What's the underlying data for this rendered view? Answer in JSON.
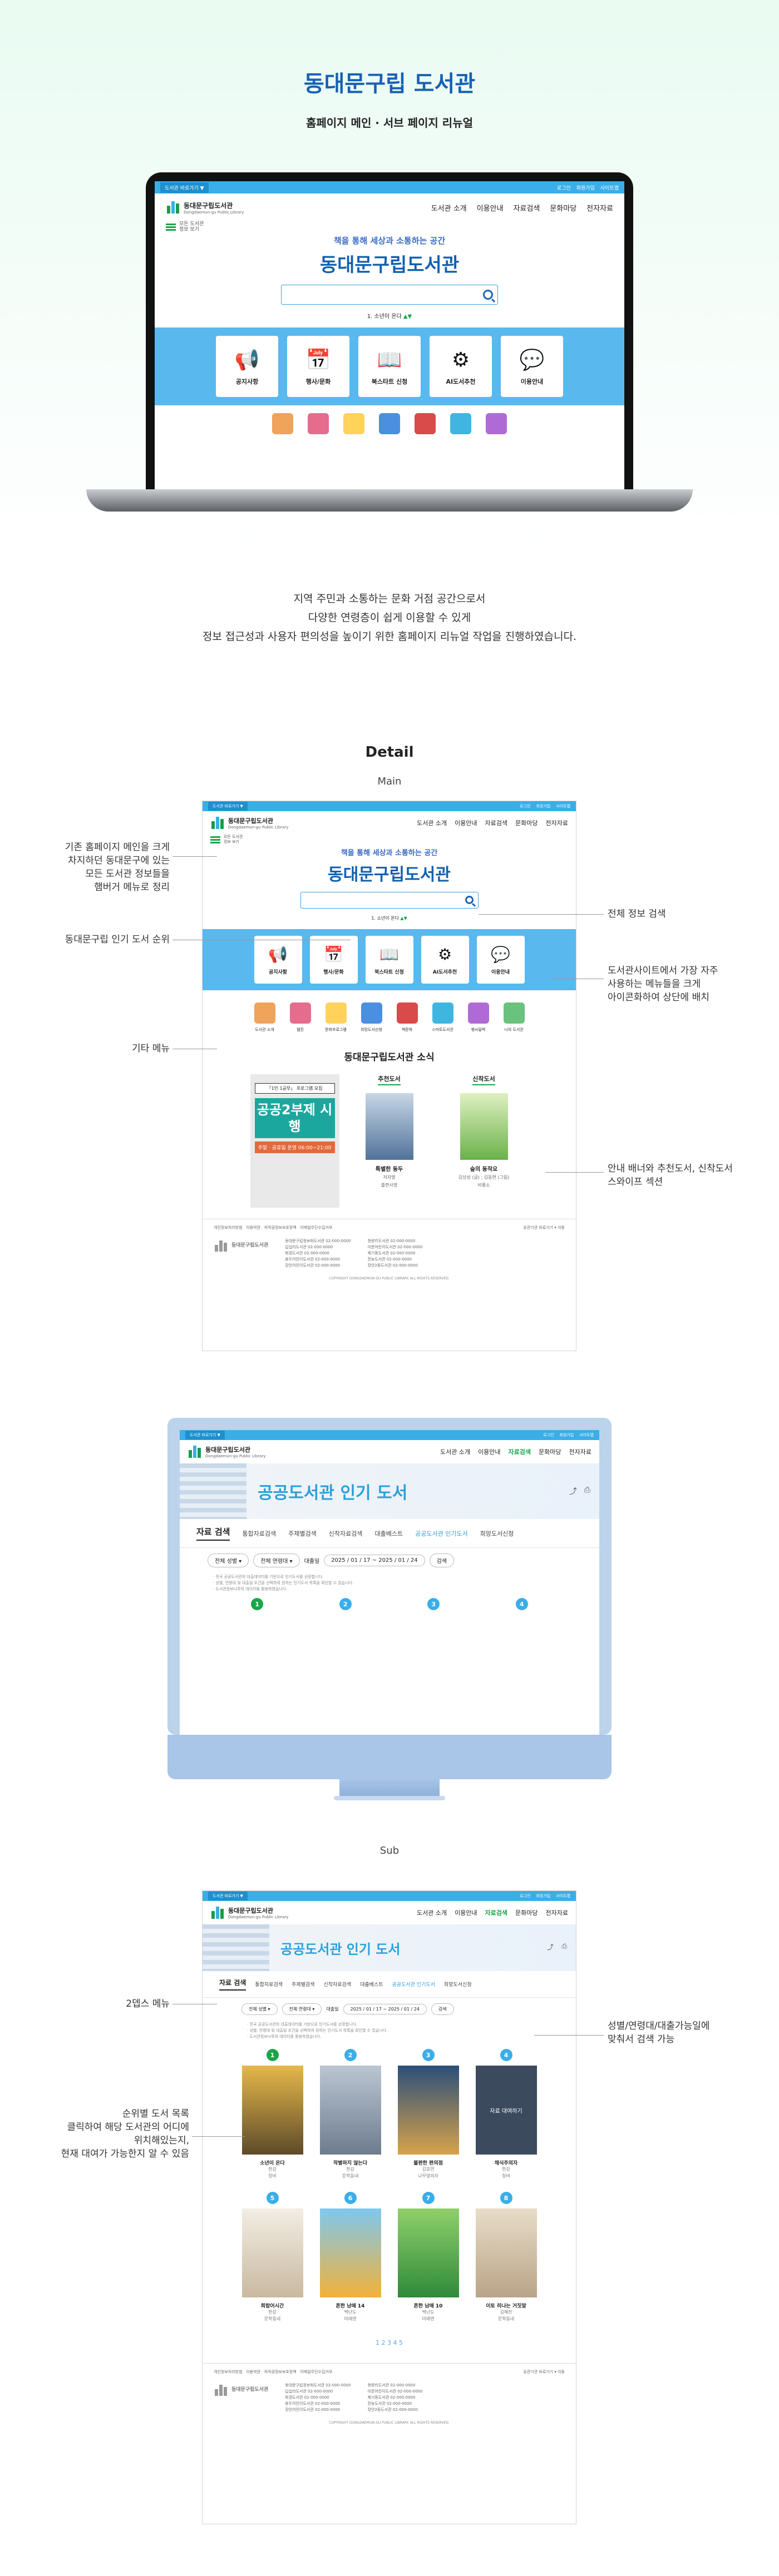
{
  "page": {
    "title": "동대문구립 도서관",
    "subtitle": "홈페이지 메인 · 서브 페이지 리뉴얼",
    "description": [
      "지역 주민과 소통하는 문화 거점 공간으로서",
      "다양한 연령층이 쉽게 이용할 수 있게",
      "정보 접근성과 사용자 편의성을 높이기 위한 홈페이지 리뉴얼 작업을 진행하였습니다."
    ],
    "detail_heading": "Detail",
    "main_label": "Main",
    "sub_label": "Sub"
  },
  "site": {
    "top_select": "도서관 바로가기 ▼",
    "top_links": [
      "로그인",
      "회원가입",
      "사이트맵"
    ],
    "logo_name": "동대문구립도서관",
    "logo_en": "Dongdaemun-gu Public Library",
    "gnb": [
      "도서관 소개",
      "이용안내",
      "자료검색",
      "문화마당",
      "전자자료"
    ],
    "sitemap_label": [
      "모든 도서관",
      "정보 보기"
    ],
    "slogan": "책을 통해 세상과 소통하는 공간",
    "big_title": "동대문구립도서관",
    "popular_rank": "1. 소년이 온다",
    "quick_menu": [
      "공지사항",
      "행사/문화",
      "북스타트 신청",
      "AI도서추천",
      "이용안내"
    ],
    "quick_icons": [
      "megaphone-icon",
      "calendar-icon",
      "book-icon",
      "gear-icon",
      "chat-icon"
    ],
    "etc_menu": [
      "도서관 소개",
      "웹진",
      "문화프로그램",
      "희망도서신청",
      "책문화",
      "스마트도서관",
      "행사달력",
      "나의 도서관"
    ],
    "news_title": "동대문구립도서관 소식",
    "banner": {
      "small": "「1인 1공부」 프로그램 모집",
      "big": "공공2부제 시행",
      "time": "주말 · 공휴일 운영 06:00~21:00"
    },
    "recommend": {
      "head": "추천도서",
      "title": "특별한 동두",
      "meta": [
        "저자명",
        "출판사명"
      ]
    },
    "newbook": {
      "head": "신착도서",
      "title": "숲의 동작요",
      "meta": [
        "김상성 (글) ; 김동현 (그림)",
        "비룡소"
      ]
    },
    "footer_links": [
      "개인정보처리방침",
      "이용약관",
      "저작권정보보호정책",
      "이메일무단수집거부"
    ],
    "footer_site": "유관기관 바로가기 ▾",
    "footer_site_btn": "이동",
    "footer_cols": [
      [
        "동대문구립정보화도서관 02-000-0000",
        "답십리도서관 02-000-0000",
        "휘경도서관 02-000-0000",
        "용두어린이도서관 02-000-0000",
        "장안어린이도서관 02-000-0000"
      ],
      [
        "청량리도서관 02-000-0000",
        "이문어린이도서관 02-000-0000",
        "제기동도서관 02-000-0000",
        "전농도서관 02-000-0000",
        "장안2동도서관 02-000-0000"
      ]
    ],
    "copyright": "COPYRIGHT DONGDAEMUN-GU PUBLIC LIBRARY. ALL RIGHTS RESERVED."
  },
  "callouts": {
    "left1": [
      "기존 홈페이지 메인을 크게",
      "차지하던 동대문구에 있는",
      "모든 도서관 정보들을",
      "햄버거 메뉴로 정리"
    ],
    "left2": [
      "동대문구립 인기 도서 순위"
    ],
    "left3": [
      "기타 메뉴"
    ],
    "right1": [
      "전체 정보 검색"
    ],
    "right2": [
      "도서관사이트에서 가장 자주",
      "사용하는 메뉴들을 크게",
      "아이콘화하여 상단에 배치"
    ],
    "right3": [
      "안내 배너와 추천도서, 신착도서",
      "스와이프 섹션"
    ],
    "sub_left1": [
      "2뎁스 메뉴"
    ],
    "sub_left2": [
      "순위별 도서 목록",
      "클릭하여 해당 도서관의 어디에",
      "위치해있는지,",
      "현재 대여가 가능한지 알 수 있음"
    ],
    "sub_right1": [
      "성별/연령대/대출가능일에",
      "맞춰서 검색 가능"
    ]
  },
  "subpage": {
    "hero_title": "공공도서관 인기 도서",
    "lead_tab": "자료 검색",
    "tabs": [
      "통합자료검색",
      "주제별검색",
      "신착자료검색",
      "대출베스트",
      "공공도서관 인기도서",
      "희망도서신청"
    ],
    "filters": [
      "전체 성별",
      "전체 연령대",
      "대출일"
    ],
    "date_range": "2025 / 01 / 17 ~ 2025 / 01 / 24",
    "search_btn": "검색",
    "notice": [
      "· 전국 공공도서관의 대출데이터를 기반으로 인기도서를 선정합니다.",
      "· 성별, 연령대 및 대출일 조건을 선택하여 원하는 인기도서 목록을 확인할 수 있습니다.",
      "· 도서관정보나루의 데이터를 활용하였습니다."
    ],
    "ranks": [
      "1",
      "2",
      "3",
      "4"
    ],
    "books": [
      {
        "title": "소년이 온다",
        "author": "한강",
        "pub": "창비"
      },
      {
        "title": "작별하지 않는다",
        "author": "한강",
        "pub": "문학동네"
      },
      {
        "title": "불편한 편의점",
        "author": "김호연",
        "pub": "나무옆의자"
      },
      {
        "title": "채식주의자",
        "author": "한강",
        "pub": "창비"
      },
      {
        "title": "희랍어시간",
        "author": "한강",
        "pub": "문학동네"
      },
      {
        "title": "흔한 남매 14",
        "author": "백난도",
        "pub": "미래엔"
      },
      {
        "title": "흔한 남매 10",
        "author": "백난도",
        "pub": "미래엔"
      },
      {
        "title": "이토 히나는 거짓말",
        "author": "김혜진",
        "pub": "문학동네"
      }
    ],
    "hover_label": "자료 대여하기",
    "pager": "1  2  3  4  5"
  },
  "colors": {
    "accent": "#1760b5",
    "green": "#19a64a",
    "sky": "#59b8ee"
  }
}
